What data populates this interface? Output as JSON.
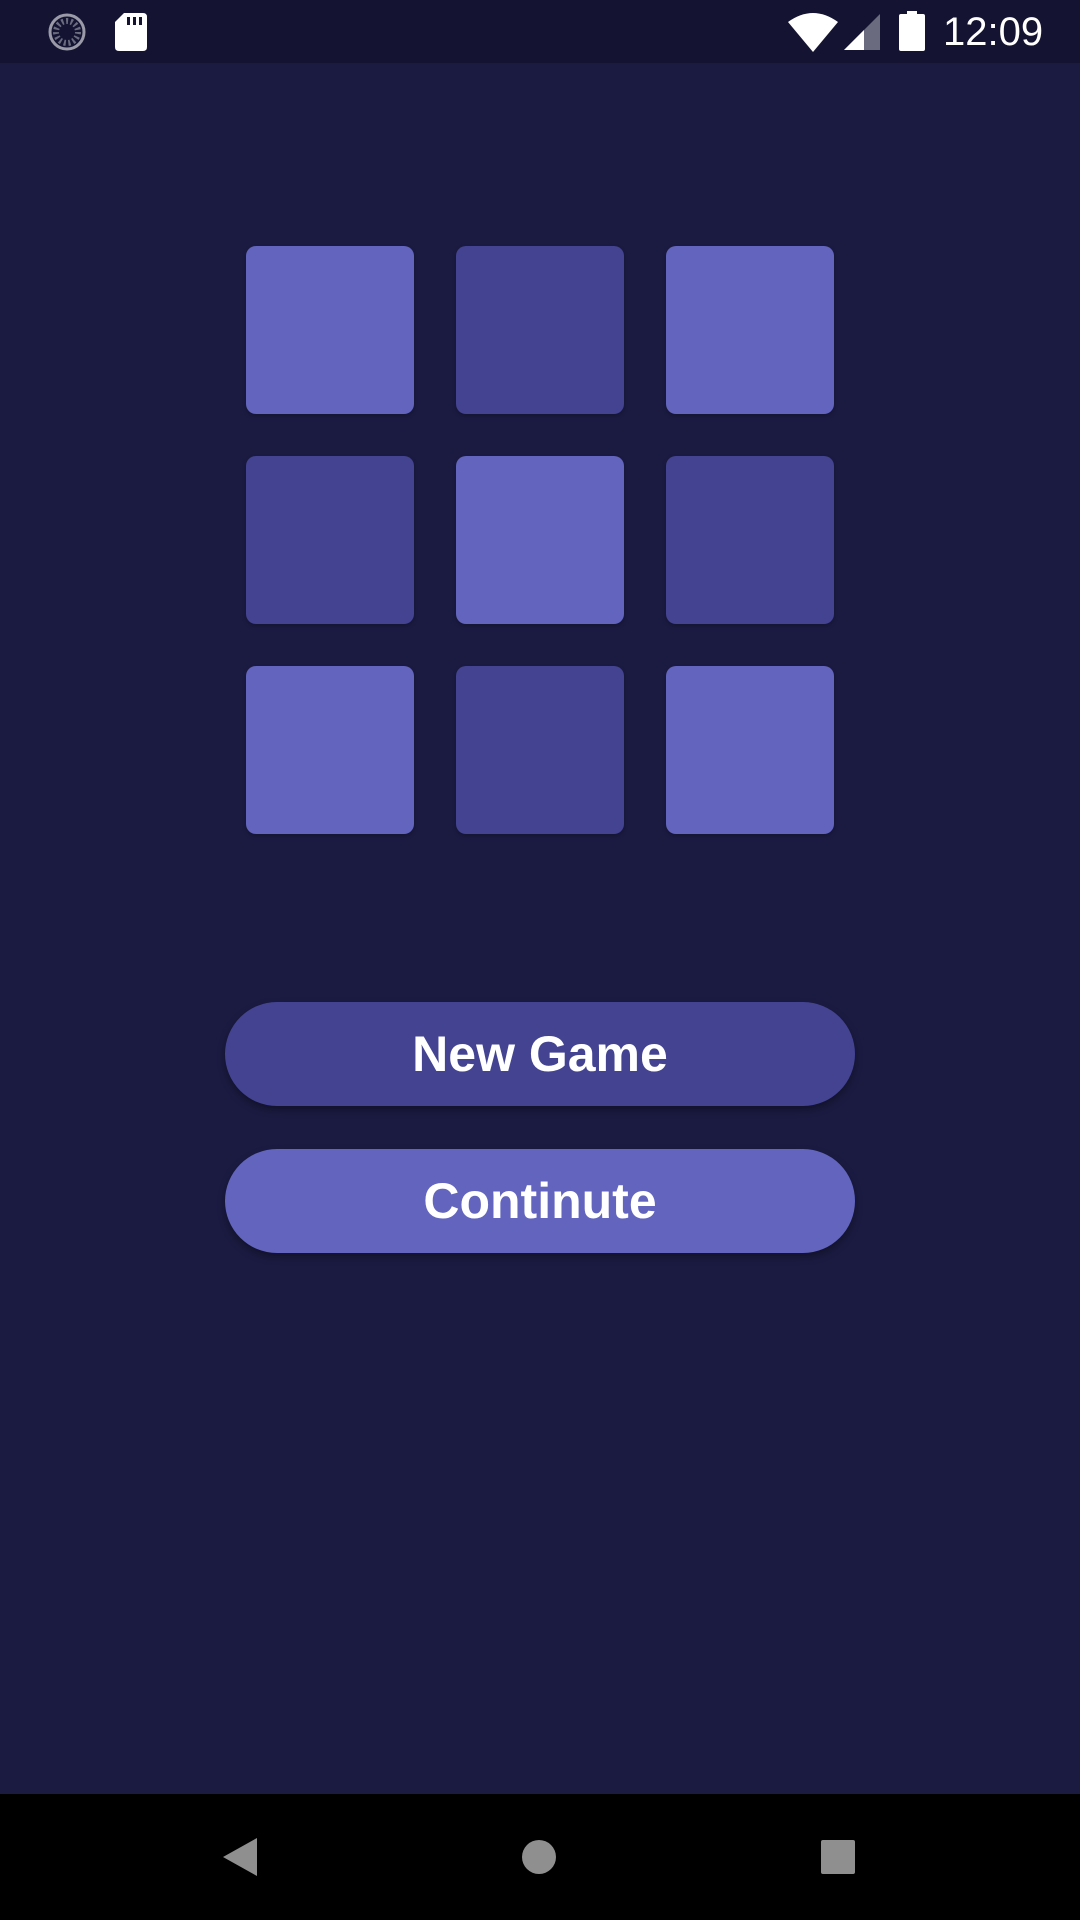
{
  "status_bar": {
    "time": "12:09",
    "icons": [
      "loading-spinner-icon",
      "sd-card-icon",
      "wifi-icon",
      "cell-signal-icon",
      "battery-icon"
    ]
  },
  "board": {
    "rows": 3,
    "cols": 3,
    "tiles": [
      [
        "light",
        "dark",
        "light"
      ],
      [
        "dark",
        "light",
        "dark"
      ],
      [
        "light",
        "dark",
        "light"
      ]
    ],
    "colors": {
      "light": "#6264bd",
      "dark": "#434392",
      "background": "#1b1b42"
    }
  },
  "buttons": {
    "new_game": "New Game",
    "continue": "Continute"
  },
  "nav_bar": {
    "icons": [
      "back-icon",
      "home-icon",
      "recent-apps-icon"
    ]
  }
}
